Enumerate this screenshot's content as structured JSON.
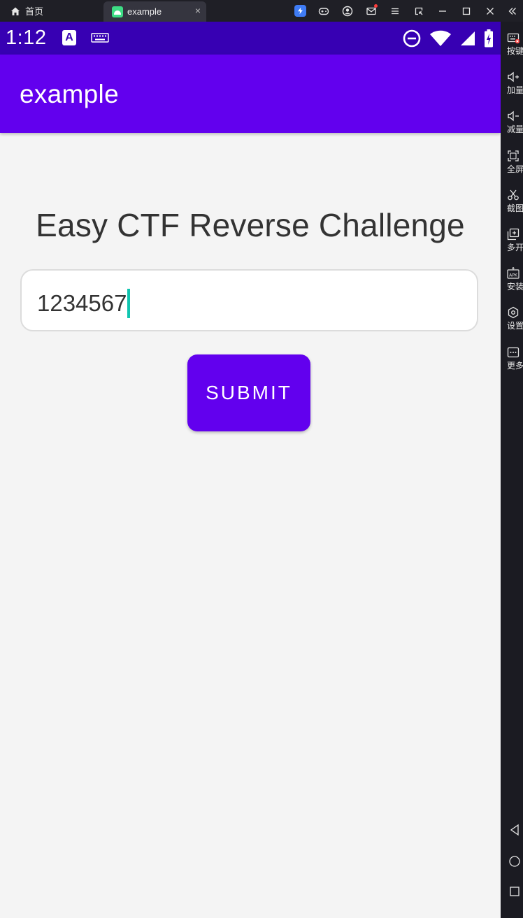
{
  "emulator": {
    "home_label": "首页",
    "tab_label": "example",
    "tab_close": "×"
  },
  "sidebar": {
    "items": [
      {
        "label": "按键",
        "icon": "keyboard-icon"
      },
      {
        "label": "加量",
        "icon": "volume-up-icon"
      },
      {
        "label": "减量",
        "icon": "volume-down-icon"
      },
      {
        "label": "全屏",
        "icon": "fullscreen-icon"
      },
      {
        "label": "截图",
        "icon": "scissors-icon"
      },
      {
        "label": "多开",
        "icon": "multi-instance-icon"
      },
      {
        "label": "安装",
        "icon": "apk-install-icon"
      },
      {
        "label": "设置",
        "icon": "settings-icon"
      },
      {
        "label": "更多",
        "icon": "more-icon"
      }
    ]
  },
  "status_bar": {
    "time": "1:12",
    "a_icon": "A"
  },
  "app_bar": {
    "title": "example"
  },
  "main": {
    "heading": "Easy CTF Reverse Challenge",
    "input_value": "1234567",
    "submit_label": "SUBMIT"
  },
  "colors": {
    "primary": "#6200ee",
    "primary_dark": "#3700b3",
    "background": "#f4f4f4",
    "caret": "#11c5b0"
  }
}
